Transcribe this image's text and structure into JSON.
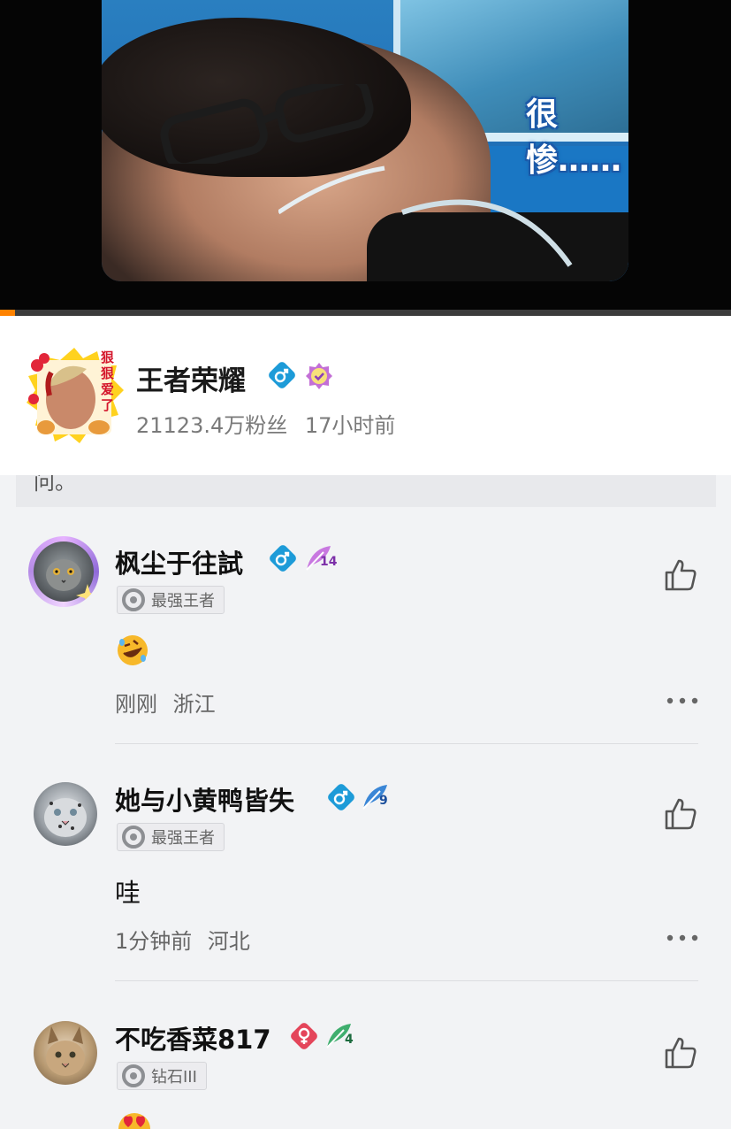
{
  "video": {
    "caption": "很惨……",
    "progress_fraction": 0.02
  },
  "author": {
    "name": "王者荣耀",
    "avatar_text": "狠狠爱了",
    "followers": "21123.4万粉丝",
    "time": "17小时前"
  },
  "hidden_text": "问。",
  "comments": [
    {
      "user": "枫尘于往試",
      "gender": "male",
      "level": "14",
      "rank": "最强王者",
      "text": "",
      "emoji": "rofl",
      "time": "刚刚",
      "location": "浙江"
    },
    {
      "user": "她与小黄鸭皆失",
      "gender": "male",
      "level": "9",
      "rank": "最强王者",
      "text": "哇",
      "time": "1分钟前",
      "location": "河北"
    },
    {
      "user": "不吃香菜817",
      "gender": "female",
      "level": "4",
      "rank": "钻石III",
      "emoji": "heart-eyes"
    }
  ],
  "colors": {
    "progress": "#ff8200",
    "male_badge": "#1d9bd8",
    "female_badge": "#e4455a",
    "verified": "#c36fd6"
  }
}
